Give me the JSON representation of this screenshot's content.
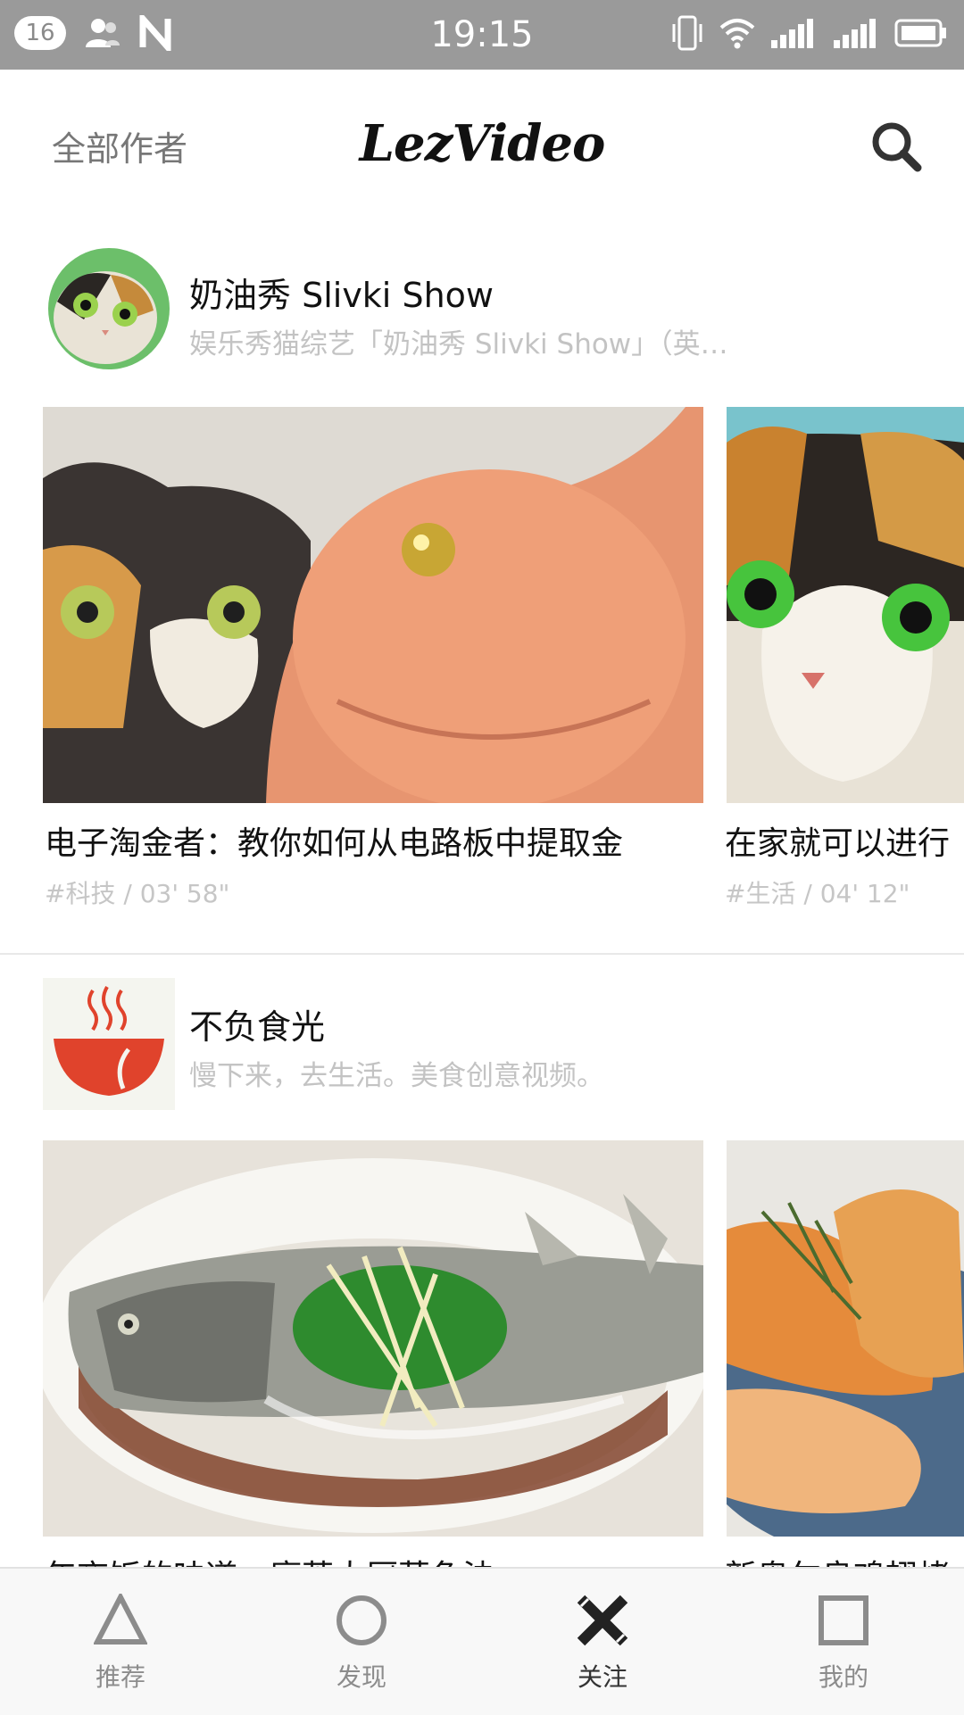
{
  "status_bar": {
    "notification_count": "16",
    "time": "19:15",
    "icons": [
      "contacts-icon",
      "n-app-icon",
      "vibrate-icon",
      "wifi-icon",
      "signal-sim2-icon",
      "signal-sim1-icon",
      "battery-icon"
    ]
  },
  "header": {
    "left_link": "全部作者",
    "logo": "LezVideo",
    "search_icon": "search-icon"
  },
  "feed": [
    {
      "author_name": "奶油秀 Slivki Show",
      "author_desc": "娱乐秀猫综艺「奶油秀 Slivki Show」（英…",
      "videos": [
        {
          "title": "电子淘金者：教你如何从电路板中提取金",
          "meta": "#科技  /  03' 58\""
        },
        {
          "title": "在家就可以进行",
          "meta": "#生活  /  04' 12\""
        }
      ]
    },
    {
      "author_name": "不负食光",
      "author_desc": "慢下来，去生活。美食创意视频。",
      "videos": [
        {
          "title": "年夜饭的味道，廖莱大厨蒸鱼法",
          "meta": ""
        },
        {
          "title": "新奥尔良鸡翅烤",
          "meta": ""
        }
      ]
    }
  ],
  "bottom_nav": {
    "tabs": [
      {
        "label": "推荐",
        "icon": "triangle-icon"
      },
      {
        "label": "发现",
        "icon": "circle-icon"
      },
      {
        "label": "关注",
        "icon": "cross-icon",
        "active": true
      },
      {
        "label": "我的",
        "icon": "square-icon"
      }
    ]
  },
  "colors": {
    "status_bar": "#9a9a9a",
    "text_primary": "#111111",
    "text_secondary": "#c3c3c3",
    "nav_bg": "#f8f8f8"
  }
}
